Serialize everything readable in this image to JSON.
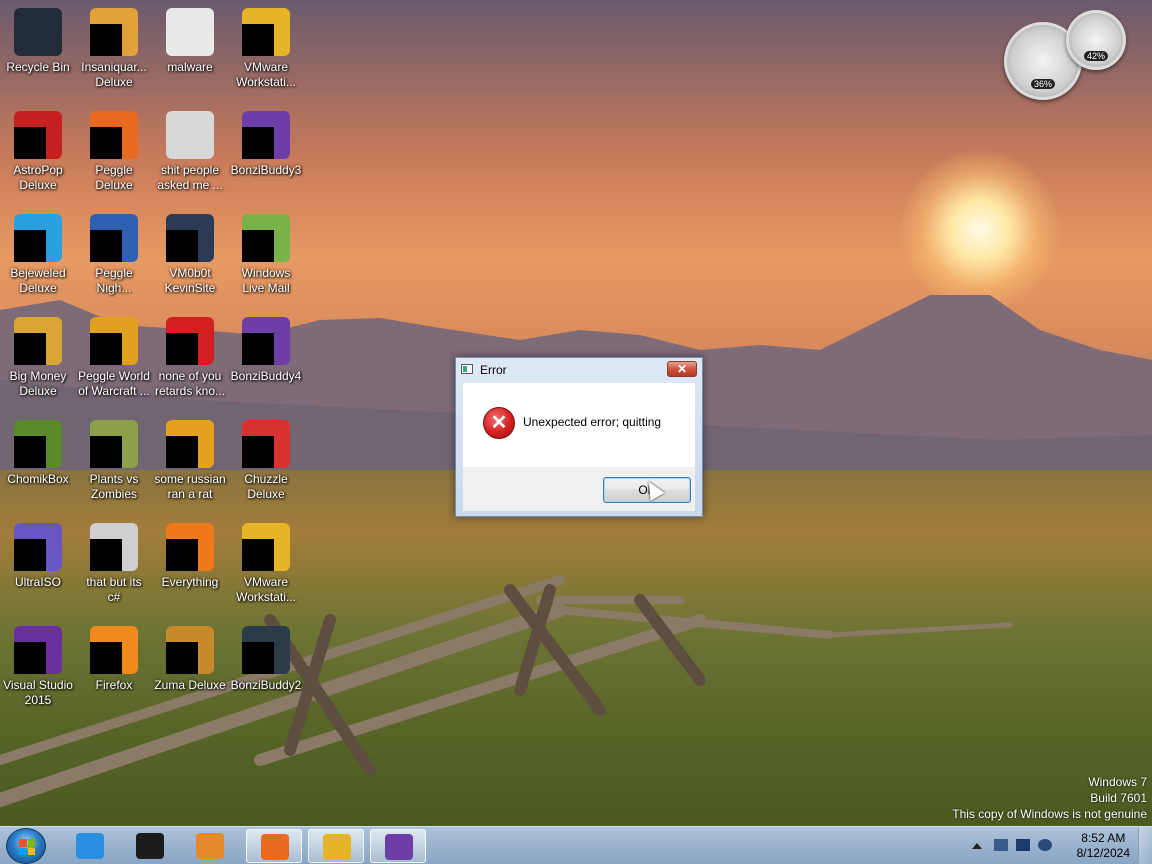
{
  "desktop": {
    "icons": [
      {
        "label": "Recycle Bin",
        "icon": "recycle-bin-icon",
        "color": "#222b38",
        "blk": false
      },
      {
        "label": "Insaniquar...\nDeluxe",
        "icon": "fish-game-icon",
        "color": "#e2a23a",
        "blk": true
      },
      {
        "label": "malware",
        "icon": "folder-icon",
        "color": "#e9e9e9",
        "blk": false
      },
      {
        "label": "VMware\nWorkstati...",
        "icon": "vmware-icon",
        "color": "#e6b527",
        "blk": true
      },
      {
        "label": "AstroPop\nDeluxe",
        "icon": "astropop-icon",
        "color": "#c62020",
        "blk": true
      },
      {
        "label": "Peggle\nDeluxe",
        "icon": "peggle-icon",
        "color": "#e86a1e",
        "blk": true
      },
      {
        "label": "shit people\nasked me ...",
        "icon": "folder-icon",
        "color": "#d8d8d8",
        "blk": false
      },
      {
        "label": "BonziBuddy3",
        "icon": "bonzibuddy-icon",
        "color": "#6e3ea8",
        "blk": true
      },
      {
        "label": "Bejeweled\nDeluxe",
        "icon": "bejeweled-icon",
        "color": "#2aa0e0",
        "blk": true
      },
      {
        "label": "Peggle\nNigh...",
        "icon": "peggle-nights-icon",
        "color": "#2e5fb0",
        "blk": true
      },
      {
        "label": "VM0b0t\nKevinSite",
        "icon": "vm-site-icon",
        "color": "#2b3a55",
        "blk": true
      },
      {
        "label": "Windows\nLive Mail",
        "icon": "live-mail-icon",
        "color": "#7ab24a",
        "blk": true
      },
      {
        "label": "Big Money\nDeluxe",
        "icon": "big-money-icon",
        "color": "#d9a535",
        "blk": true
      },
      {
        "label": "Peggle World\nof Warcraft ...",
        "icon": "peggle-wow-icon",
        "color": "#e0a020",
        "blk": true
      },
      {
        "label": "none of you\nretards kno...",
        "icon": "red-swirl-icon",
        "color": "#d22020",
        "blk": true
      },
      {
        "label": "BonziBuddy4",
        "icon": "bonzibuddy-icon",
        "color": "#6e3ea8",
        "blk": true
      },
      {
        "label": "ChomikBox",
        "icon": "chomikbox-icon",
        "color": "#5a8a2a",
        "blk": true
      },
      {
        "label": "Plants vs\nZombies",
        "icon": "plants-zombies-icon",
        "color": "#8ea04a",
        "blk": true
      },
      {
        "label": "some russian\nran a rat",
        "icon": "russian-rat-icon",
        "color": "#e6a020",
        "blk": true
      },
      {
        "label": "Chuzzle\nDeluxe",
        "icon": "chuzzle-icon",
        "color": "#d93030",
        "blk": true
      },
      {
        "label": "UltraISO",
        "icon": "ultraiso-icon",
        "color": "#6a55c4",
        "blk": true
      },
      {
        "label": "that but its\nc#",
        "icon": "copy-files-icon",
        "color": "#cfcfcf",
        "blk": true
      },
      {
        "label": "Everything",
        "icon": "everything-search-icon",
        "color": "#f07a1a",
        "blk": true
      },
      {
        "label": "VMware\nWorkstati...",
        "icon": "vmware-icon",
        "color": "#e6b527",
        "blk": true
      },
      {
        "label": "Visual Studio\n2015",
        "icon": "visual-studio-icon",
        "color": "#6a2f9e",
        "blk": true
      },
      {
        "label": "Firefox",
        "icon": "firefox-icon",
        "color": "#f08a1e",
        "blk": true
      },
      {
        "label": "Zuma Deluxe",
        "icon": "zuma-icon",
        "color": "#c88a2a",
        "blk": true
      },
      {
        "label": "BonziBuddy2",
        "icon": "bonzibuddy-icon",
        "color": "#2a3c4a",
        "blk": true
      }
    ],
    "gadgets": [
      {
        "name": "cpu-meter-gadget",
        "pct": "36%"
      },
      {
        "name": "ram-meter-gadget",
        "pct": "42%"
      }
    ],
    "watermark": {
      "line1": "Windows 7",
      "line2": "Build 7601",
      "line3": "This copy of Windows is not genuine"
    }
  },
  "dialog": {
    "title": "Error",
    "close_label": "✕",
    "message": "Unexpected error; quitting",
    "ok_label": "OK"
  },
  "taskbar": {
    "items": [
      {
        "name": "taskbar-internet-explorer",
        "icon": "internet-explorer-icon",
        "color": "#2a8fe0",
        "active": false
      },
      {
        "name": "taskbar-black-box",
        "icon": "black-box-icon",
        "color": "#1c1c1c",
        "active": false
      },
      {
        "name": "taskbar-media-player",
        "icon": "media-player-icon",
        "color": "#e58a2a",
        "active": false
      },
      {
        "name": "taskbar-firefox",
        "icon": "firefox-icon",
        "color": "#e86a1e",
        "active": true
      },
      {
        "name": "taskbar-vmware",
        "icon": "vmware-icon",
        "color": "#e6b527",
        "active": true
      },
      {
        "name": "taskbar-bonzibuddy",
        "icon": "bonzibuddy-icon",
        "color": "#6e3ea8",
        "active": true
      }
    ],
    "time": "8:52 AM",
    "date": "8/12/2024"
  }
}
